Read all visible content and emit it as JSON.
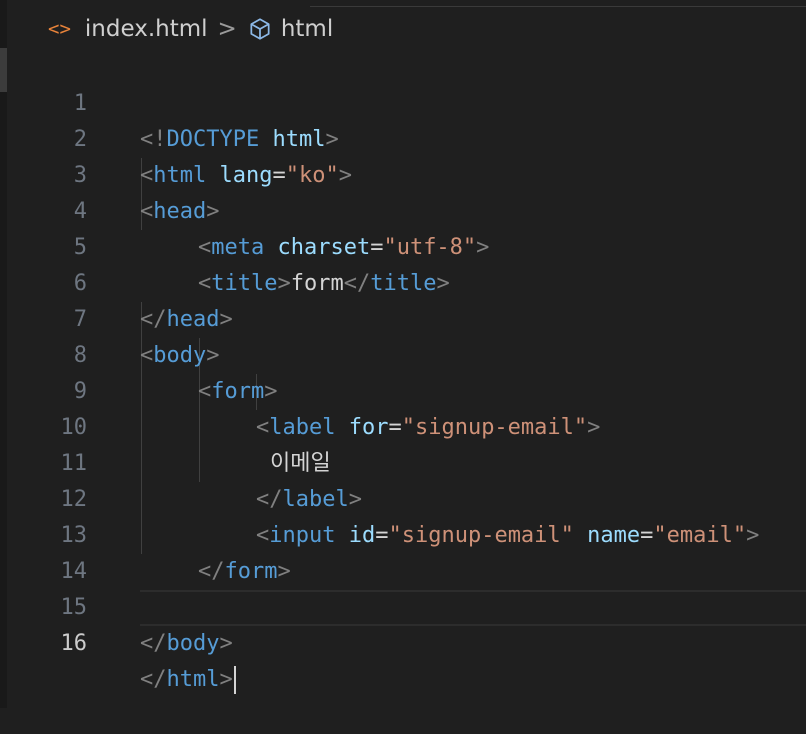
{
  "breadcrumb": {
    "file_icon": "<>",
    "file_name": "index.html",
    "separator": ">",
    "symbol_icon": "cube-icon",
    "symbol_name": "html"
  },
  "editor": {
    "current_line": 16,
    "colors": {
      "background": "#1f1f1f",
      "tag": "#569cd6",
      "punctuation": "#808080",
      "attribute": "#9cdcfe",
      "string": "#ce9178",
      "text": "#d4d4d4",
      "line_number": "#6e7681"
    },
    "line_numbers": [
      "1",
      "2",
      "3",
      "4",
      "5",
      "6",
      "7",
      "8",
      "9",
      "10",
      "11",
      "12",
      "13",
      "14",
      "15",
      "16"
    ],
    "tokens": {
      "l1": [
        "<!",
        "DOCTYPE",
        " html",
        ">"
      ],
      "l2": [
        "<",
        "html",
        " lang",
        "=",
        "\"ko\"",
        ">"
      ],
      "l3": [
        "<",
        "head",
        ">"
      ],
      "l4": [
        "<",
        "meta",
        " charset",
        "=",
        "\"utf-8\"",
        ">"
      ],
      "l5": [
        "<",
        "title",
        ">",
        "form",
        "</",
        "title",
        ">"
      ],
      "l6": [
        "</",
        "head",
        ">"
      ],
      "l7": [
        "<",
        "body",
        ">"
      ],
      "l8": [
        "<",
        "form",
        ">"
      ],
      "l9": [
        "<",
        "label",
        " for",
        "=",
        "\"signup-email\"",
        ">"
      ],
      "l10": [
        "이메일"
      ],
      "l11": [
        "</",
        "label",
        ">"
      ],
      "l12": [
        "<",
        "input",
        " id",
        "=",
        "\"signup-email\"",
        " name",
        "=",
        "\"email\"",
        ">"
      ],
      "l13": [
        "</",
        "form",
        ">"
      ],
      "l14": [],
      "l15": [
        "</",
        "body",
        ">"
      ],
      "l16": [
        "</",
        "html",
        ">"
      ]
    }
  }
}
